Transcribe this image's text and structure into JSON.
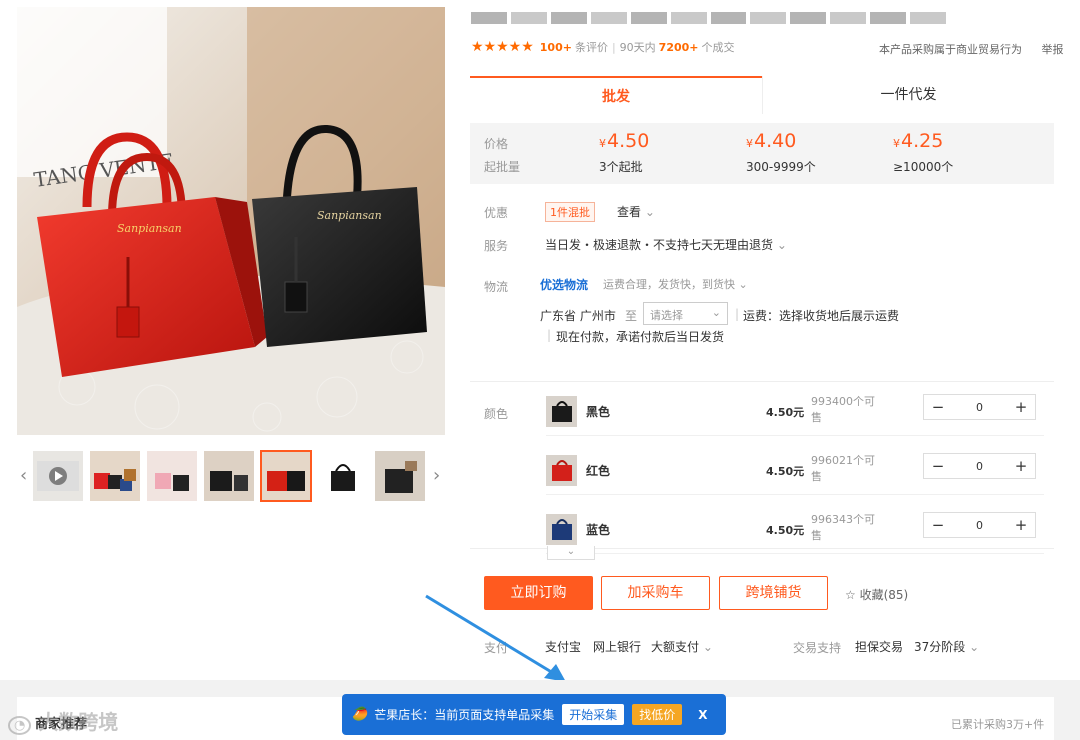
{
  "gallery": {
    "prev_arrow": "‹",
    "next_arrow": "›"
  },
  "rating": {
    "review_count": "100+",
    "review_suffix": "条评价",
    "period": "90天内",
    "deals": "7200+",
    "deals_suffix": "个成交"
  },
  "top_right": {
    "notice": "本产品采购属于商业贸易行为",
    "report": "举报"
  },
  "tabs": [
    "批发",
    "一件代发"
  ],
  "price_box": {
    "price_label": "价格",
    "moq_label": "起批量",
    "currency": "¥",
    "tiers": [
      {
        "price": "4.50",
        "moq": "3个起批"
      },
      {
        "price": "4.40",
        "moq": "300-9999个"
      },
      {
        "price": "4.25",
        "moq": "≥10000个"
      }
    ]
  },
  "promo": {
    "label": "优惠",
    "badge": "1件混批",
    "view": "查看"
  },
  "service": {
    "label": "服务",
    "text": "当日发・极速退款・不支持七天无理由退货"
  },
  "logistics": {
    "label": "物流",
    "highlight": "优选物流",
    "desc": "运费合理，发货快，到货快",
    "origin": "广东省 广州市",
    "to": "至",
    "dest_placeholder": "请选择",
    "freight": "运费：选择收货地后展示运费",
    "note": "现在付款，承诺付款后当日发货"
  },
  "sku": {
    "label": "颜色",
    "items": [
      {
        "name": "黑色",
        "price": "4.50元",
        "stock": "993400个可售",
        "qty": "0"
      },
      {
        "name": "红色",
        "price": "4.50元",
        "stock": "996021个可售",
        "qty": "0"
      },
      {
        "name": "蓝色",
        "price": "4.50元",
        "stock": "996343个可售",
        "qty": "0"
      }
    ]
  },
  "actions": {
    "buy": "立即订购",
    "cart": "加采购车",
    "cross": "跨境铺货",
    "favorite": "收藏(85)"
  },
  "payment": {
    "label": "支付",
    "methods": [
      "支付宝",
      "网上银行",
      "大额支付"
    ],
    "trade_label": "交易支持",
    "guarantee": "担保交易",
    "installment": "37分阶段"
  },
  "merchant": {
    "title": "商家推荐",
    "stat": "已累计采购3万+件"
  },
  "watermark": "大数跨境",
  "plugin": {
    "text": "芒果店长：当前页面支持单品采集",
    "start": "开始采集",
    "cheap": "找低价",
    "close": "X"
  },
  "colors": {
    "accent": "#ff5a1f",
    "plugin_bg": "#1a6fd6",
    "arrow": "#2f8fe0"
  }
}
